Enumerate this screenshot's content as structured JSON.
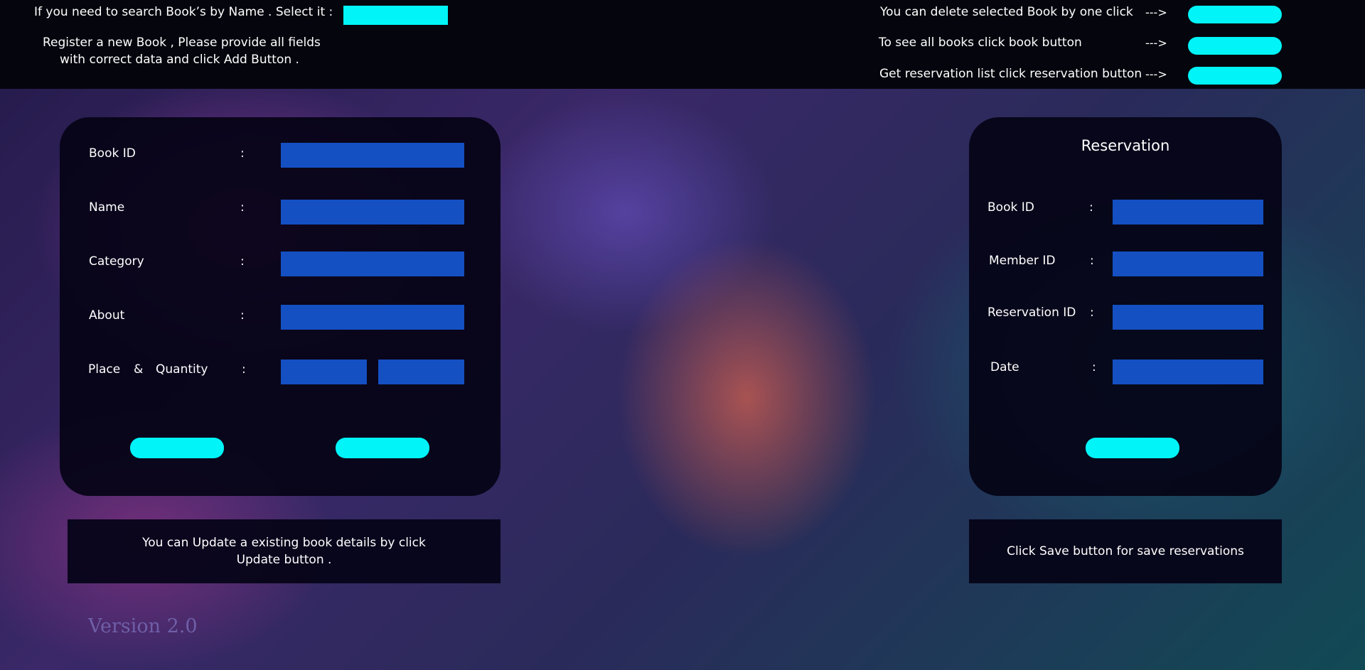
{
  "topbar": {
    "search_text": "If you need to search Book’s by Name . Select it :",
    "search_value": "",
    "register_line1": "Register a new Book , Please provide all fields",
    "register_line2": "with correct data and click Add Button .",
    "delete_text": "You can delete selected Book by one click",
    "books_text": "To see all books click book button",
    "reservation_text": "Get reservation list click reservation button",
    "arrow": "--->"
  },
  "book_form": {
    "book_id_label": "Book ID",
    "name_label": "Name",
    "category_label": "Category",
    "about_label": "About",
    "place_label": "Place",
    "amp": "&",
    "quantity_label": "Quantity",
    "colon": ":"
  },
  "reservation_form": {
    "title": "Reservation",
    "book_id_label": "Book ID",
    "member_id_label": "Member ID",
    "reservation_id_label": "Reservation ID",
    "date_label": "Date",
    "colon": ":"
  },
  "info": {
    "update_line1": "You can Update a existing book details by click",
    "update_line2": "Update button .",
    "save_text": "Click Save button for save reservations"
  },
  "footer": {
    "version": "Version 2.0"
  },
  "colors": {
    "accent": "#00f4f8",
    "field": "#1450c2",
    "panel": "#05031a"
  }
}
